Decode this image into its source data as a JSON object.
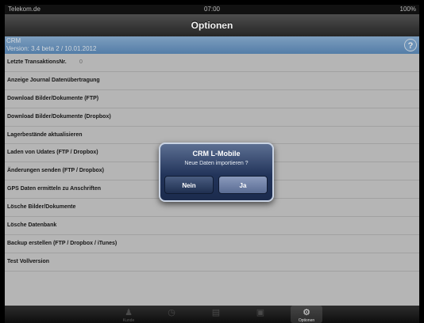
{
  "status_bar": {
    "carrier": "Telekom.de",
    "time": "07:00",
    "battery": "100%"
  },
  "nav": {
    "title": "Optionen"
  },
  "header": {
    "app": "CRM",
    "version": "Version: 3.4 beta 2 / 10.01.2012",
    "help_icon": "?"
  },
  "list": [
    {
      "label": "Letzte TransaktionsNr.",
      "value": "0"
    },
    {
      "label": "Anzeige Journal Datenübertragung",
      "value": ""
    },
    {
      "label": "Download Bilder/Dokumente (FTP)",
      "value": ""
    },
    {
      "label": "Download Bilder/Dokumente (Dropbox)",
      "value": ""
    },
    {
      "label": "Lagerbestände aktualisieren",
      "value": ""
    },
    {
      "label": "Laden von Udates (FTP / Dropbox)",
      "value": ""
    },
    {
      "label": "Änderungen senden (FTP / Dropbox)",
      "value": ""
    },
    {
      "label": "GPS Daten ermitteln zu Anschriften",
      "value": ""
    },
    {
      "label": "Lösche Bilder/Dokumente",
      "value": ""
    },
    {
      "label": "Lösche Datenbank",
      "value": ""
    },
    {
      "label": "Backup erstellen (FTP / Dropbox / iTunes)",
      "value": ""
    },
    {
      "label": "Test Vollversion",
      "value": ""
    }
  ],
  "alert": {
    "title": "CRM L-Mobile",
    "message": "Neue Daten importieren ?",
    "no_label": "Nein",
    "yes_label": "Ja"
  },
  "tabbar": [
    {
      "label": "Kunde",
      "icon": "person-icon"
    },
    {
      "label": "",
      "icon": "clock-icon"
    },
    {
      "label": "",
      "icon": "chart-icon"
    },
    {
      "label": "",
      "icon": "cart-icon"
    },
    {
      "label": "Optionen",
      "icon": "gear-icon"
    }
  ]
}
